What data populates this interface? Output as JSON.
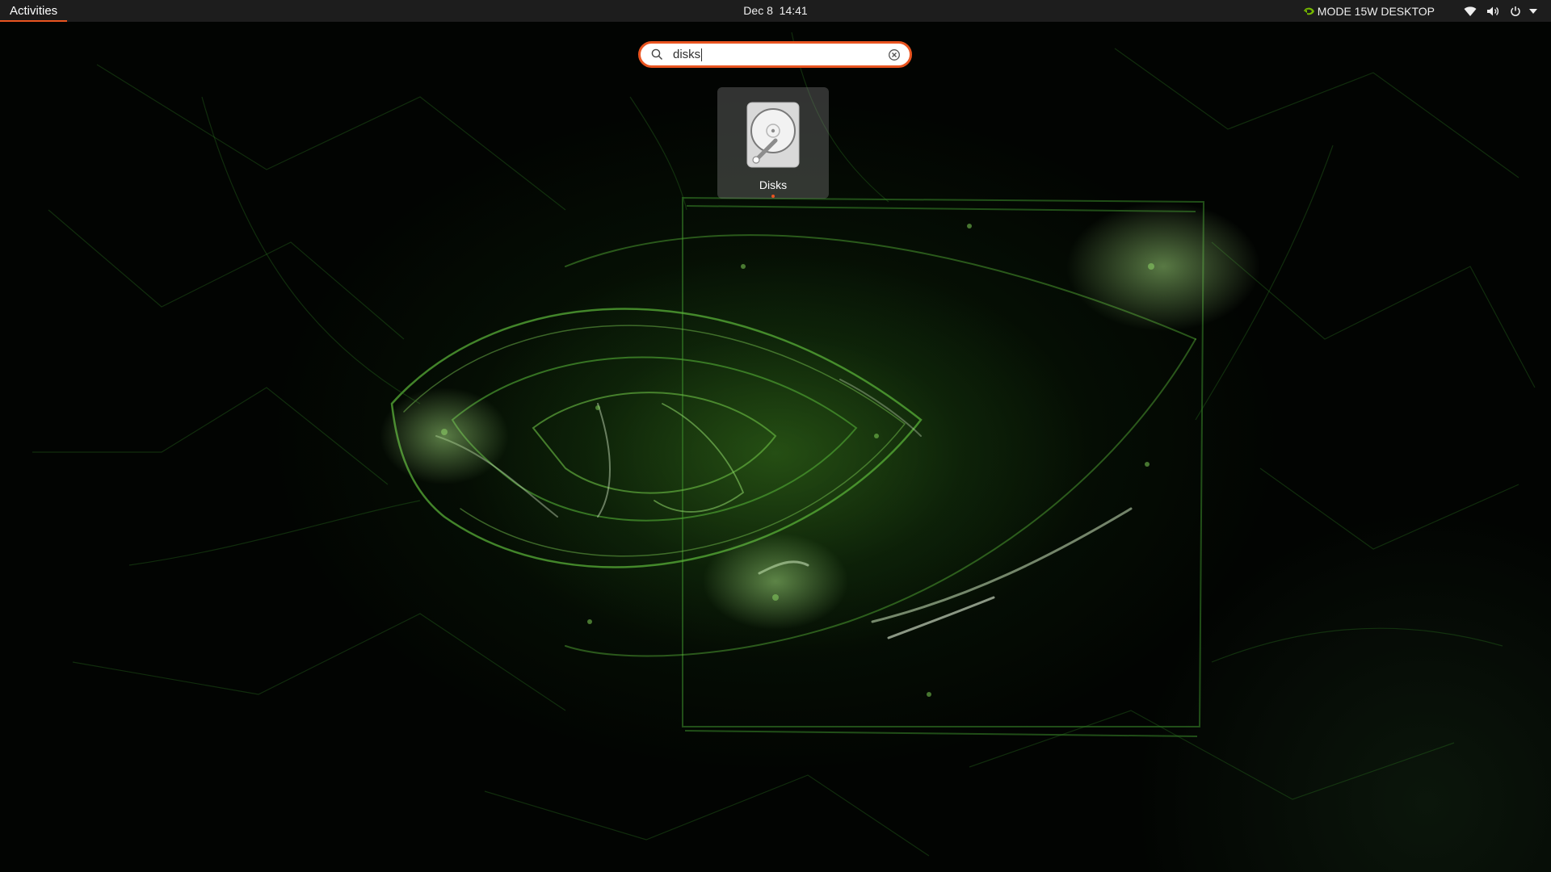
{
  "topbar": {
    "activities_label": "Activities",
    "clock": "Dec 8  14:41",
    "power_mode_label": "MODE 15W DESKTOP",
    "tray_icons": [
      "nvidia-icon",
      "network-wifi-icon",
      "volume-icon",
      "power-icon",
      "chevron-down-icon"
    ]
  },
  "search": {
    "value": "disks",
    "icon": "search-icon",
    "clear_icon": "clear-icon"
  },
  "results": [
    {
      "label": "Disks",
      "icon": "disks-app-icon",
      "running": true
    }
  ],
  "colors": {
    "accent": "#e95420",
    "topbar_bg": "#1d1d1d",
    "wallpaper_green": "#3a8a2a"
  }
}
